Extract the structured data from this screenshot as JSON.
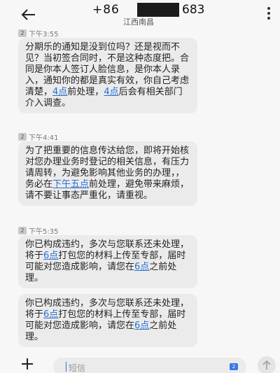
{
  "header": {
    "number_prefix": "+86",
    "number_suffix": "683",
    "location": "江西南昌"
  },
  "messages": [
    {
      "sim": "2",
      "time": "下午3:55",
      "segments": [
        {
          "text": "分期乐的通知是没到位吗？还是视而不见？当初签合同时，不是这种态度把。合同是你本人签订人脸信息，是你本人录入，通知你的都是真实有效，你自己考虑清楚，",
          "link": false
        },
        {
          "text": "4点",
          "link": true
        },
        {
          "text": "前处理，",
          "link": false
        },
        {
          "text": "4点",
          "link": true
        },
        {
          "text": "后会有相关部门介入调查。",
          "link": false
        }
      ]
    },
    {
      "sim": "2",
      "time": "下午4:41",
      "segments": [
        {
          "text": "为了把重要的信息传达给您，即将开始核对您办理业务时登记的相关信息，有压力请周转，为避免影响其他业务的办理，，务必在",
          "link": false
        },
        {
          "text": "下午五点",
          "link": true
        },
        {
          "text": "前处理，避免带来麻烦，请不要让事态严重化，请重视。",
          "link": false
        }
      ]
    },
    {
      "sim": "2",
      "time": "下午5:35",
      "segments": [
        {
          "text": "你已构成违约，多次与您联系还未处理，将于",
          "link": false
        },
        {
          "text": "6点",
          "link": true
        },
        {
          "text": "打包您的材料上传至专部，届时可能对您造成影响，请您在",
          "link": false
        },
        {
          "text": "6点",
          "link": true
        },
        {
          "text": "之前处理。",
          "link": false
        }
      ]
    },
    {
      "sim": "",
      "time": "",
      "segments": [
        {
          "text": "你已构成违约，多次与您联系还未处理，将于",
          "link": false
        },
        {
          "text": "6点",
          "link": true
        },
        {
          "text": "打包您的材料上传至专部，届时可能对您造成影响，请您在",
          "link": false
        },
        {
          "text": "6点",
          "link": true
        },
        {
          "text": "之前处理。",
          "link": false
        }
      ]
    }
  ],
  "input": {
    "placeholder": "短信",
    "sim": "2"
  },
  "icons": {
    "back": "arrow-left-icon",
    "more": "more-vertical-icon",
    "add": "plus-icon",
    "send": "send-arrow-icon"
  },
  "colors": {
    "bubble": "#ebebeb",
    "link": "#2a6fd1",
    "background": "#f7f7f7"
  }
}
